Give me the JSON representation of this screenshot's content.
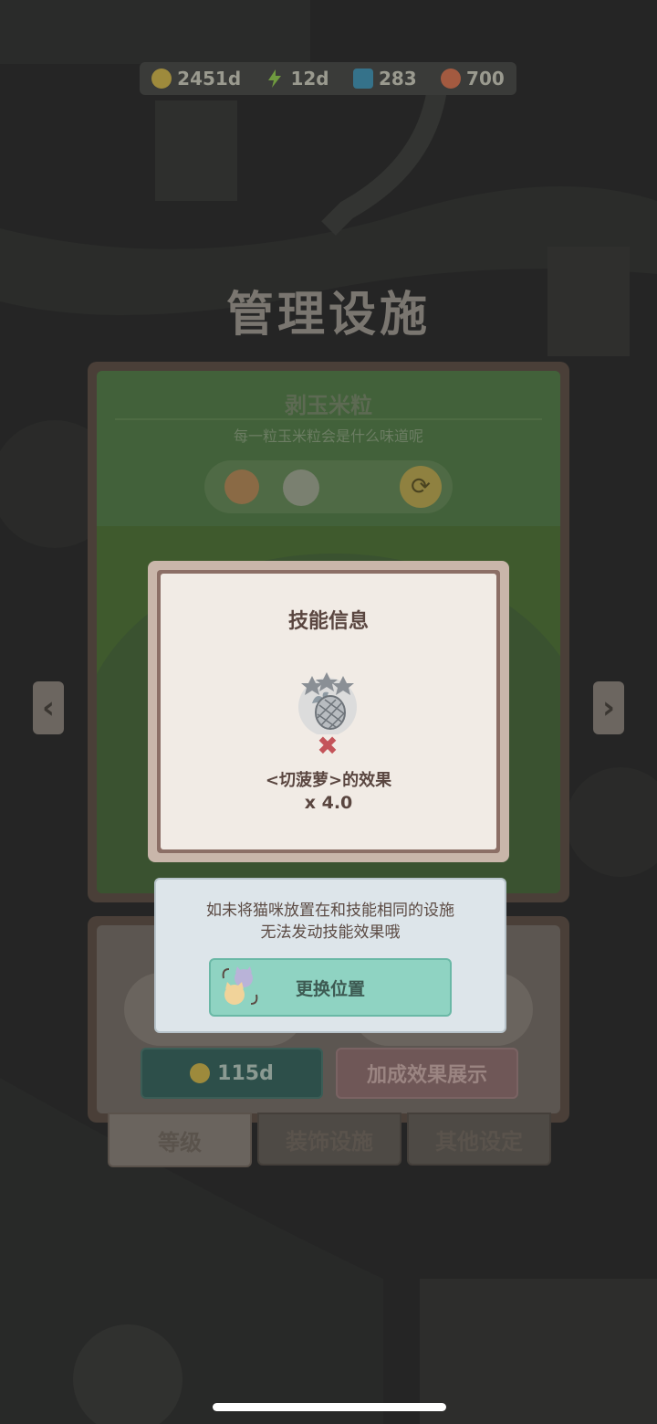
{
  "resources": [
    {
      "icon": "coin-icon",
      "value": "2451d",
      "color": "#b8a143"
    },
    {
      "icon": "lightning-icon",
      "value": "12d",
      "color": "#6f9a3f"
    },
    {
      "icon": "gem-icon",
      "value": "283",
      "color": "#3d8fa8"
    },
    {
      "icon": "fish-can-icon",
      "value": "700",
      "color": "#c06848"
    }
  ],
  "page_title": "管理设施",
  "facility": {
    "name": "剥玉米粒",
    "description": "每一粒玉米粒会是什么味道呢"
  },
  "skill_modal": {
    "title": "技能信息",
    "effect_text": "<切菠萝>的效果",
    "multiplier": "x 4.0"
  },
  "warning": {
    "text_line1": "如未将猫咪放置在和技能相同的设施",
    "text_line2": "无法发动技能效果哦",
    "button_label": "更换位置"
  },
  "lower_panel": {
    "upgrade_cost": "115d",
    "bonus_button": "加成效果展示"
  },
  "tabs": [
    "等级",
    "装饰设施",
    "其他设定"
  ]
}
